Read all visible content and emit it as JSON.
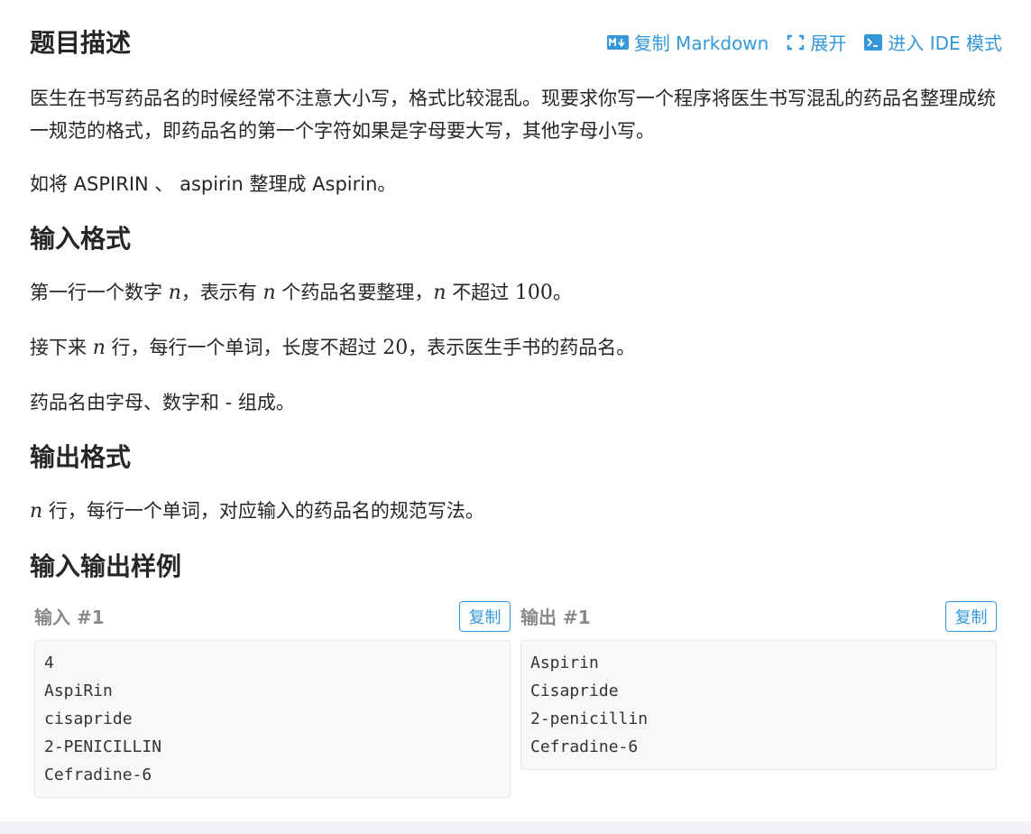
{
  "header": {
    "title": "题目描述",
    "actions": [
      {
        "label": "复制 Markdown",
        "icon": "markdown-icon"
      },
      {
        "label": "展开",
        "icon": "expand-icon"
      },
      {
        "label": "进入 IDE 模式",
        "icon": "terminal-icon"
      }
    ]
  },
  "description": {
    "p1": "医生在书写药品名的时候经常不注意大小写，格式比较混乱。现要求你写一个程序将医生书写混乱的药品名整理成统一规范的格式，即药品名的第一个字符如果是字母要大写，其他字母小写。",
    "p2": "如将 ASPIRIN 、 aspirin 整理成 Aspirin。"
  },
  "input_format": {
    "heading": "输入格式",
    "p1": {
      "t1": "第一行一个数字 ",
      "n1": "n",
      "t2": "，表示有 ",
      "n2": "n",
      "t3": " 个药品名要整理，",
      "n3": "n",
      "t4": " 不超过 ",
      "num": "100",
      "t5": "。"
    },
    "p2": {
      "t1": "接下来 ",
      "n1": "n",
      "t2": " 行，每行一个单词，长度不超过 ",
      "num": "20",
      "t3": "，表示医生手书的药品名。"
    },
    "p3": "药品名由字母、数字和 - 组成。"
  },
  "output_format": {
    "heading": "输出格式",
    "p1": {
      "n1": "n",
      "t1": " 行，每行一个单词，对应输入的药品名的规范写法。"
    }
  },
  "samples": {
    "heading": "输入输出样例",
    "input": {
      "label": "输入 #1",
      "copy_label": "复制",
      "lines": [
        "4",
        "AspiRin",
        "cisapride",
        "2-PENICILLIN",
        "Cefradine-6"
      ]
    },
    "output": {
      "label": "输出 #1",
      "copy_label": "复制",
      "lines": [
        "Aspirin",
        "Cisapride",
        "2-penicillin",
        "Cefradine-6"
      ]
    }
  },
  "colors": {
    "accent": "#3498db",
    "text": "#262626",
    "muted": "#8a8a8a",
    "code_bg": "#f8f8f8"
  }
}
